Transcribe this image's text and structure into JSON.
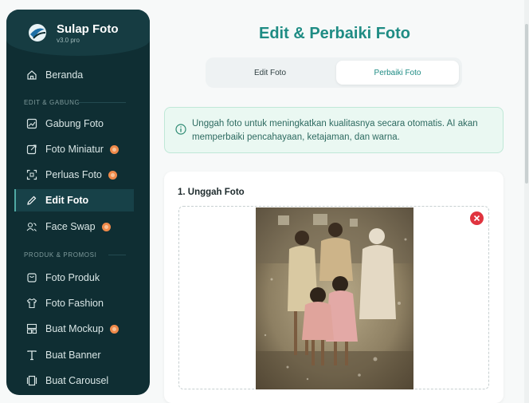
{
  "brand": {
    "name": "Sulap Foto",
    "version": "v3.0 pro"
  },
  "sidebar": {
    "home": {
      "label": "Beranda",
      "icon": "home-icon"
    },
    "sections": [
      {
        "label": "EDIT & GABUNG"
      },
      {
        "label": "PRODUK & PROMOSI"
      }
    ],
    "edit_items": [
      {
        "label": "Gabung Foto",
        "icon": "image-combine-icon",
        "badge": false
      },
      {
        "label": "Foto Miniatur",
        "icon": "miniature-icon",
        "badge": true
      },
      {
        "label": "Perluas Foto",
        "icon": "expand-icon",
        "badge": true
      },
      {
        "label": "Edit Foto",
        "icon": "pencil-icon",
        "badge": false,
        "active": true
      },
      {
        "label": "Face Swap",
        "icon": "face-swap-icon",
        "badge": true
      }
    ],
    "promo_items": [
      {
        "label": "Foto Produk",
        "icon": "product-bag-icon",
        "badge": false
      },
      {
        "label": "Foto Fashion",
        "icon": "shirt-icon",
        "badge": false
      },
      {
        "label": "Buat Mockup",
        "icon": "mockup-icon",
        "badge": true
      },
      {
        "label": "Buat Banner",
        "icon": "text-t-icon",
        "badge": false
      },
      {
        "label": "Buat Carousel",
        "icon": "carousel-icon",
        "badge": false
      }
    ]
  },
  "main": {
    "title": "Edit & Perbaiki Foto",
    "tabs": [
      {
        "label": "Edit Foto",
        "selected": false
      },
      {
        "label": "Perbaiki Foto",
        "selected": true
      }
    ],
    "info": {
      "text": "Unggah foto untuk meningkatkan kualitasnya secara otomatis. AI akan memperbaiki pencahayaan, ketajaman, dan warna."
    },
    "upload": {
      "title": "1. Unggah Foto"
    }
  },
  "colors": {
    "accent": "#1f8c84",
    "sidebar_bg": "#0f2e33",
    "badge": "#f08a4a",
    "remove": "#e0343f"
  }
}
